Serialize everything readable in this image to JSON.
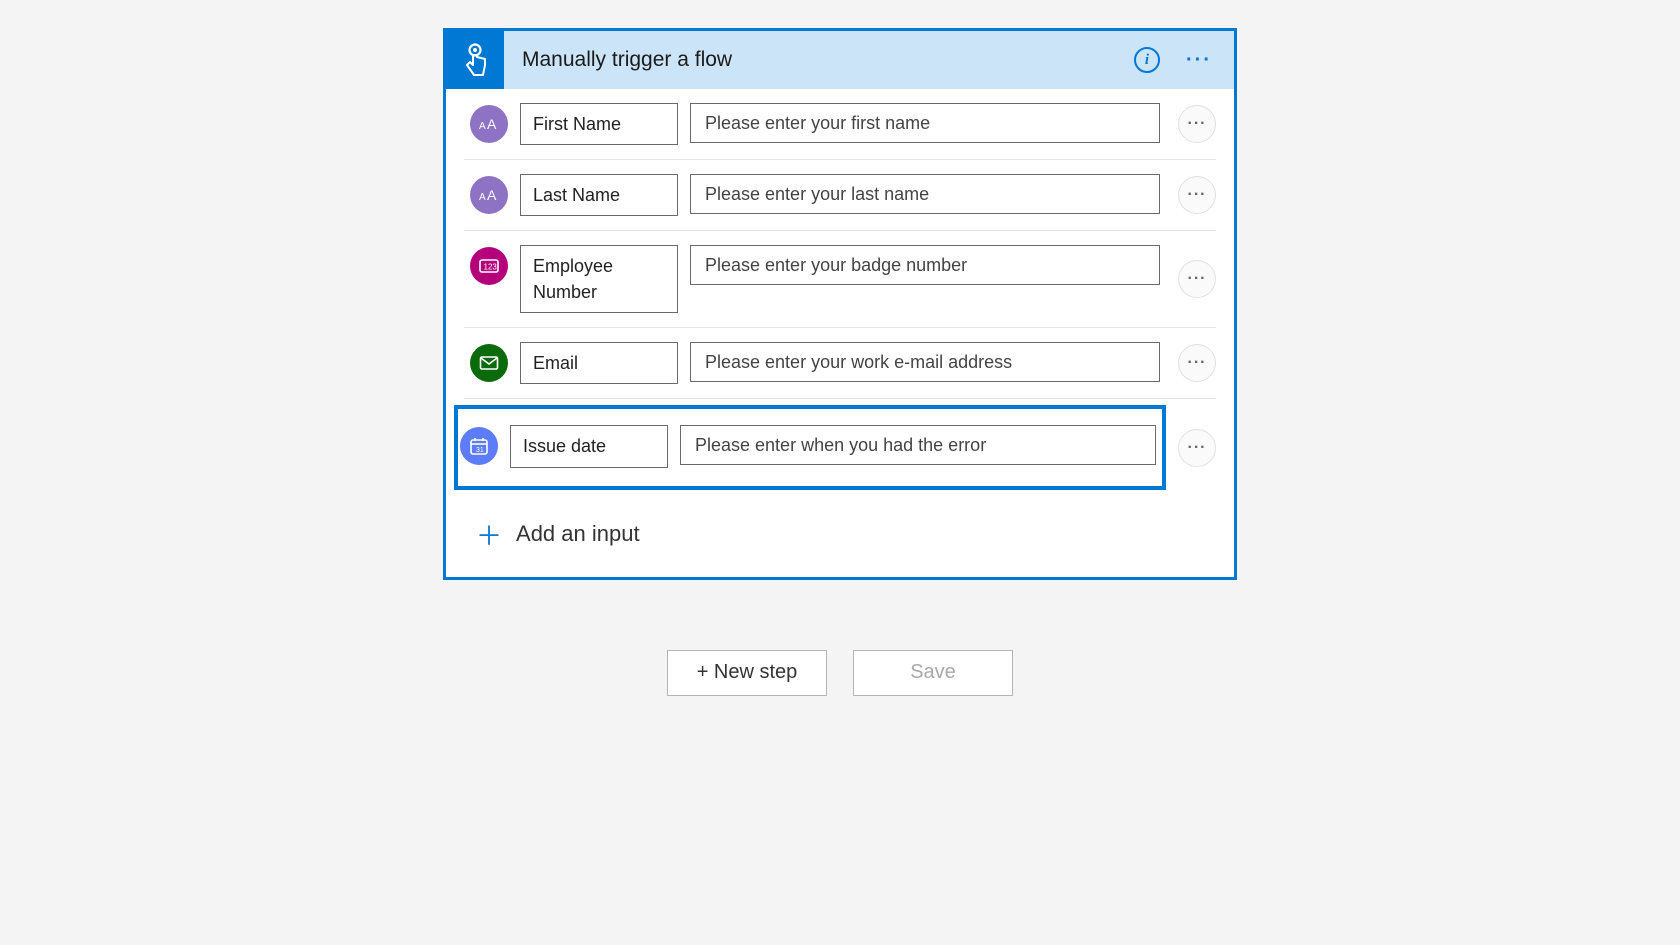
{
  "trigger": {
    "title": "Manually trigger a flow"
  },
  "inputs": [
    {
      "label": "First Name",
      "prompt": "Please enter your first name",
      "iconClass": "ti-purple",
      "iconSvg": "text",
      "selected": false
    },
    {
      "label": "Last Name",
      "prompt": "Please enter your last name",
      "iconClass": "ti-purple",
      "iconSvg": "text",
      "selected": false
    },
    {
      "label": "Employee Number",
      "prompt": "Please enter your badge number",
      "iconClass": "ti-magenta",
      "iconSvg": "number",
      "selected": false
    },
    {
      "label": "Email",
      "prompt": "Please enter your work e-mail address",
      "iconClass": "ti-green",
      "iconSvg": "email",
      "selected": false
    },
    {
      "label": "Issue date",
      "prompt": "Please enter when you had the error",
      "iconClass": "ti-blue",
      "iconSvg": "date",
      "selected": true
    }
  ],
  "actions": {
    "addInput": "Add an input",
    "newStep": "+ New step",
    "save": "Save"
  }
}
